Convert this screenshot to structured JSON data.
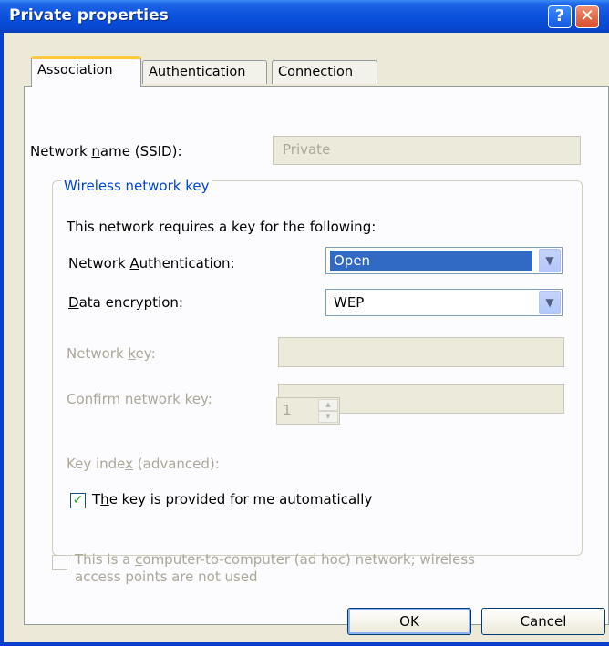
{
  "window": {
    "title": "Private properties",
    "help_label": "?",
    "close_label": "✕"
  },
  "tabs": [
    {
      "label": "Association",
      "active": true
    },
    {
      "label": "Authentication",
      "active": false
    },
    {
      "label": "Connection",
      "active": false
    }
  ],
  "association": {
    "ssid_label_pre": "Network ",
    "ssid_label_u": "n",
    "ssid_label_post": "ame (SSID):",
    "ssid_value": "Private",
    "group_title": "Wireless network key",
    "requires_text": "This network requires a key for the following:",
    "auth_label_pre": "Network ",
    "auth_label_u": "A",
    "auth_label_post": "uthentication:",
    "auth_value": "Open",
    "enc_label_u": "D",
    "enc_label_post": "ata encryption:",
    "enc_value": "WEP",
    "netkey_label_pre": "Network ",
    "netkey_label_u": "k",
    "netkey_label_post": "ey:",
    "netkey_value": "",
    "confirm_label_pre": "C",
    "confirm_label_u": "o",
    "confirm_label_post": "nfirm network key:",
    "confirm_value": "",
    "keyindex_label_pre": "Key inde",
    "keyindex_label_u": "x",
    "keyindex_label_post": " (advanced):",
    "keyindex_value": "1",
    "auto_key_pre": "T",
    "auto_key_u": "h",
    "auto_key_post": "e key is provided for me automatically",
    "auto_key_checked": true,
    "adhoc_line1_pre": "This is a ",
    "adhoc_line1_u": "c",
    "adhoc_line1_post": "omputer-to-computer (ad hoc) network; wireless",
    "adhoc_line2": "access points are not used",
    "adhoc_checked": false
  },
  "buttons": {
    "ok": "OK",
    "cancel": "Cancel"
  },
  "colors": {
    "title_bar": "#0a51dc",
    "group_title": "#0046d5",
    "selection": "#316ac5",
    "checkmark": "#21a121"
  },
  "icons": {
    "dropdown": "chevron-down-icon",
    "spin_up": "arrow-up-icon",
    "spin_down": "arrow-down-icon",
    "check": "checkmark-icon"
  }
}
